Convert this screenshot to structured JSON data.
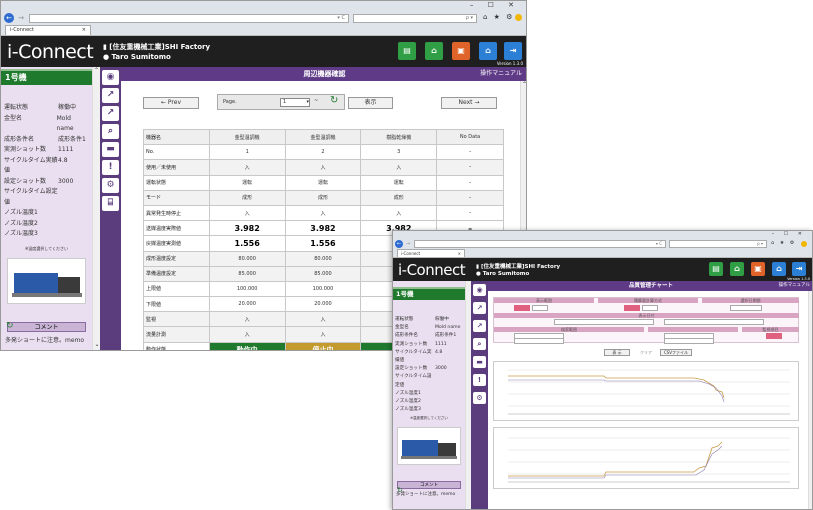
{
  "browser": {
    "tab_title": "i-Connect",
    "window_controls": "– ☐ ✕",
    "url_suffix": "▾ C",
    "search_suffix": "ρ ▾",
    "toolbar_icons": "⌂ ★ ⚙"
  },
  "header": {
    "logo": "i-Connect",
    "company": "[住友重機械工業]SHI Factory",
    "user": "Taro Sumitomo",
    "version": "Version 1.3.0",
    "icon_colors": {
      "green": "#2f9e44",
      "orange": "#e0642a",
      "blue": "#2b7fd4"
    }
  },
  "sidebar": {
    "machine": "1号機",
    "rows": [
      {
        "k": "運転状態",
        "v": "稼働中"
      },
      {
        "k": "金型名",
        "v": "Mold name"
      },
      {
        "k": "成形条件名",
        "v": "成形条件1"
      },
      {
        "k": "実測ショット数",
        "v": "1111"
      },
      {
        "k": "サイクルタイム実績値",
        "v": "4.8"
      },
      {
        "k": "設定ショット数",
        "v": "3000"
      },
      {
        "k": "サイクルタイム設定値",
        "v": ""
      },
      {
        "k": "ノズル温度1",
        "v": ""
      },
      {
        "k": "ノズル温度2",
        "v": ""
      },
      {
        "k": "ノズル温度3",
        "v": ""
      }
    ],
    "photo_caption": "※温度選択してください",
    "comment_label": "コメント",
    "comment_text": "多発ショートに注意。memo"
  },
  "main": {
    "title": "周辺機器確認",
    "manual": "操作マニュアル",
    "prev": "← Prev",
    "next": "Next →",
    "page_label": "Page.",
    "page_value": "1",
    "page_sep": "~",
    "display": "表示",
    "columns": [
      "機器名",
      "金型温調機",
      "金型温調機",
      "樹脂乾燥機",
      "No Data"
    ],
    "rows": [
      [
        "No.",
        "1",
        "2",
        "3",
        "–"
      ],
      [
        "使用／未使用",
        "入",
        "入",
        "入",
        "–"
      ],
      [
        "運転状態",
        "運転",
        "運転",
        "運転",
        "–"
      ],
      [
        "モード",
        "成形",
        "成形",
        "成形",
        "–"
      ],
      [
        "異常発生時停止",
        "入",
        "入",
        "入",
        "–"
      ],
      [
        "送媒温度実際値",
        "3.982",
        "3.982",
        "3.982",
        "–"
      ],
      [
        "戻媒温度実測値",
        "1.556",
        "1.556",
        "",
        ""
      ],
      [
        "成形温度設定",
        "80.000",
        "80.000",
        "",
        ""
      ],
      [
        "準備温度設定",
        "85.000",
        "85.000",
        "",
        ""
      ],
      [
        "上限値",
        "100.000",
        "100.000",
        "",
        ""
      ],
      [
        "下限値",
        "20.000",
        "20.000",
        "",
        ""
      ],
      [
        "監視",
        "入",
        "入",
        "",
        ""
      ],
      [
        "流量計測",
        "入",
        "入",
        "",
        ""
      ],
      [
        "動作状態",
        "動作中",
        "停止中",
        "",
        ""
      ]
    ]
  },
  "chart_window": {
    "title": "品質管理チャート",
    "manual": "操作マニュアル",
    "filter_labels": [
      "表示範囲",
      "積算量計算方式",
      "選択日期間",
      "表示日付",
      "検索範囲",
      "監視項目"
    ],
    "btn_show": "表 示",
    "btn_csv": "CSVファイル",
    "btn_clear": "クリア",
    "sidebar_machine": "1号機",
    "sidebar_rows": [
      {
        "k": "運転状態",
        "v": "稼働中"
      },
      {
        "k": "金型名",
        "v": "Mold name"
      },
      {
        "k": "成形条件名",
        "v": "成形条件1"
      },
      {
        "k": "実測ショット数",
        "v": "1111"
      },
      {
        "k": "サイクルタイム実績値",
        "v": "4.8"
      },
      {
        "k": "設定ショット数",
        "v": "3000"
      },
      {
        "k": "サイクルタイム設定値",
        "v": ""
      },
      {
        "k": "ノズル温度1",
        "v": ""
      },
      {
        "k": "ノズル温度2",
        "v": ""
      },
      {
        "k": "ノズル温度3",
        "v": ""
      }
    ],
    "photo_caption": "※温度選択してください",
    "comment_label": "コメント",
    "comment_text": "多発ショートに注意。memo"
  }
}
